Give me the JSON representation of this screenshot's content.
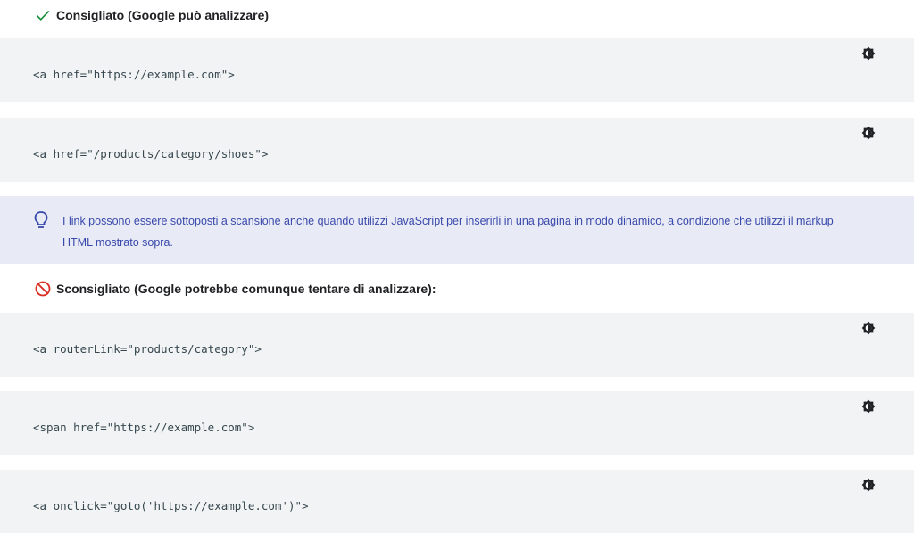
{
  "recommended": {
    "icon": "check-icon",
    "title": "Consigliato (Google può analizzare)",
    "color": "#1e8e3e"
  },
  "good_examples": [
    {
      "code": "<a href=\"https://example.com\">"
    },
    {
      "code": "<a href=\"/products/category/shoes\">"
    }
  ],
  "note": {
    "icon": "lightbulb-icon",
    "text": "I link possono essere sottoposti a scansione anche quando utilizzi JavaScript per inserirli in una pagina in modo dinamico, a condizione che utilizzi il markup HTML mostrato sopra.",
    "background": "#e8eaf6",
    "color": "#3949ab"
  },
  "not_recommended": {
    "icon": "block-icon",
    "title": "Sconsigliato (Google potrebbe comunque tentare di analizzare):",
    "color": "#d93025"
  },
  "bad_examples": [
    {
      "code": "<a routerLink=\"products/category\">"
    },
    {
      "code": "<span href=\"https://example.com\">"
    },
    {
      "code": "<a onclick=\"goto('https://example.com')\">"
    }
  ],
  "code_toggle_icon": "theme-toggle-icon"
}
